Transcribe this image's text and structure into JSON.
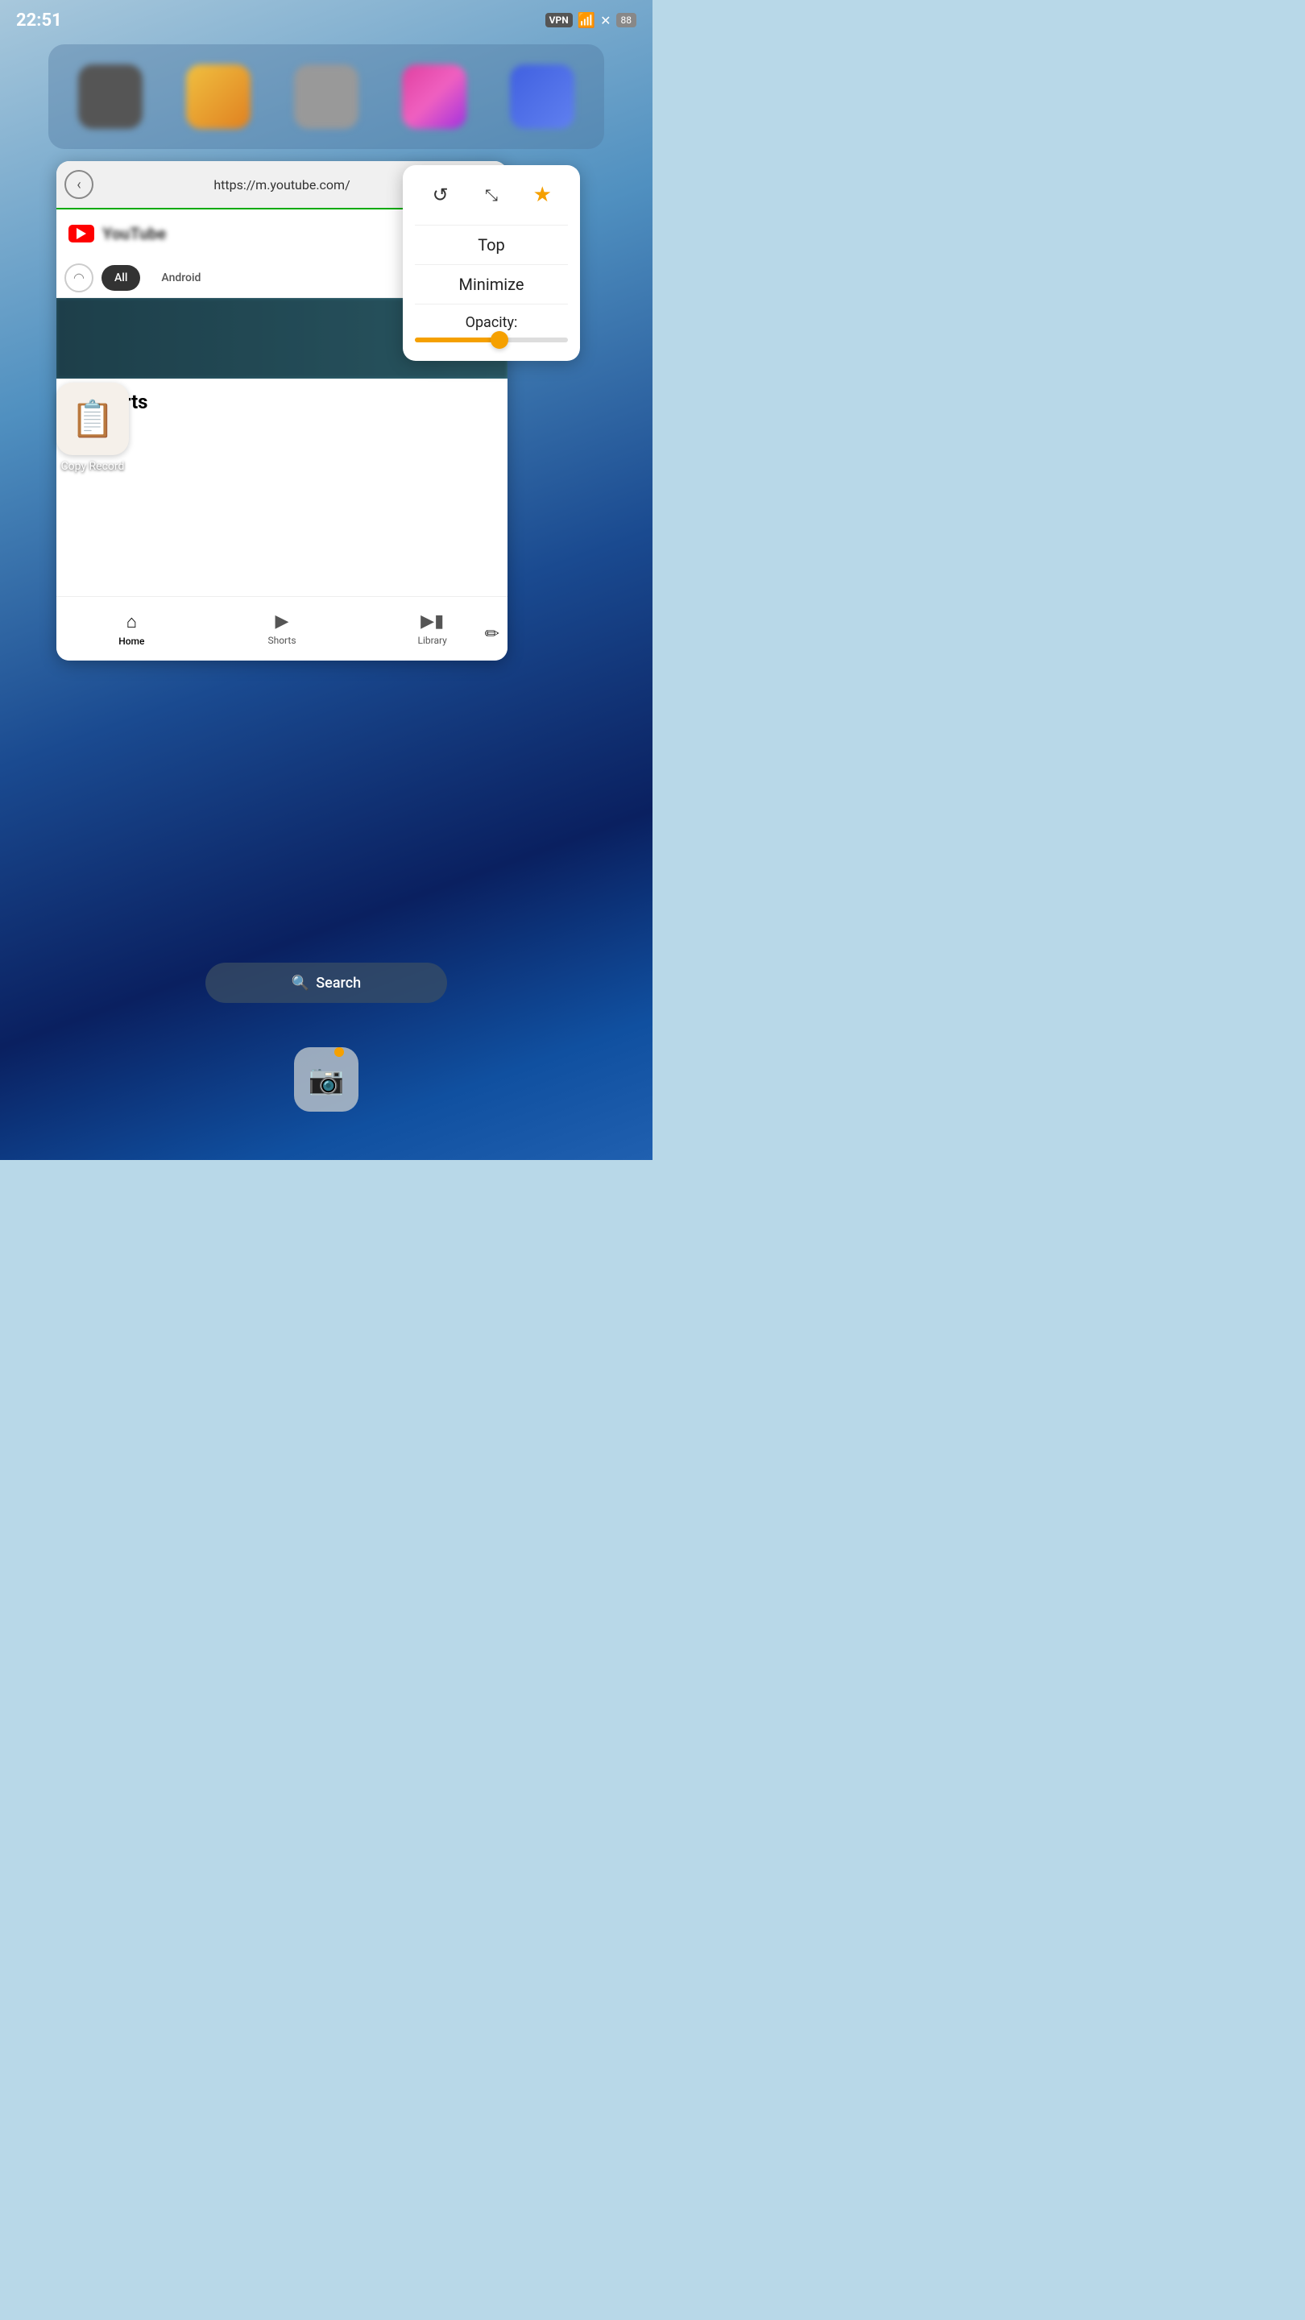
{
  "statusBar": {
    "time": "22:51",
    "vpnLabel": "VPN",
    "batteryLevel": "88"
  },
  "browserWindow": {
    "url": "https://m.youtube.com/",
    "navTabs": [
      {
        "label": "All",
        "active": true
      },
      {
        "label": "Android",
        "active": false
      }
    ]
  },
  "popupMenu": {
    "refreshIcon": "↺",
    "compressIcon": "⤢",
    "starIcon": "★",
    "topLabel": "Top",
    "minimizeLabel": "Minimize",
    "opacityLabel": "Opacity:",
    "opacityValue": 55
  },
  "copyRecord": {
    "label": "Copy Record"
  },
  "youtubeNav": {
    "homeLabel": "Home",
    "shortsLabel": "Shorts",
    "libraryLabel": "Library",
    "shortsHeading": "Shorts"
  },
  "searchBar": {
    "placeholder": "Search",
    "icon": "🔍"
  },
  "dockItems": [
    {
      "name": "app-1"
    },
    {
      "name": "app-2"
    },
    {
      "name": "app-3"
    },
    {
      "name": "app-4"
    },
    {
      "name": "app-5"
    }
  ]
}
